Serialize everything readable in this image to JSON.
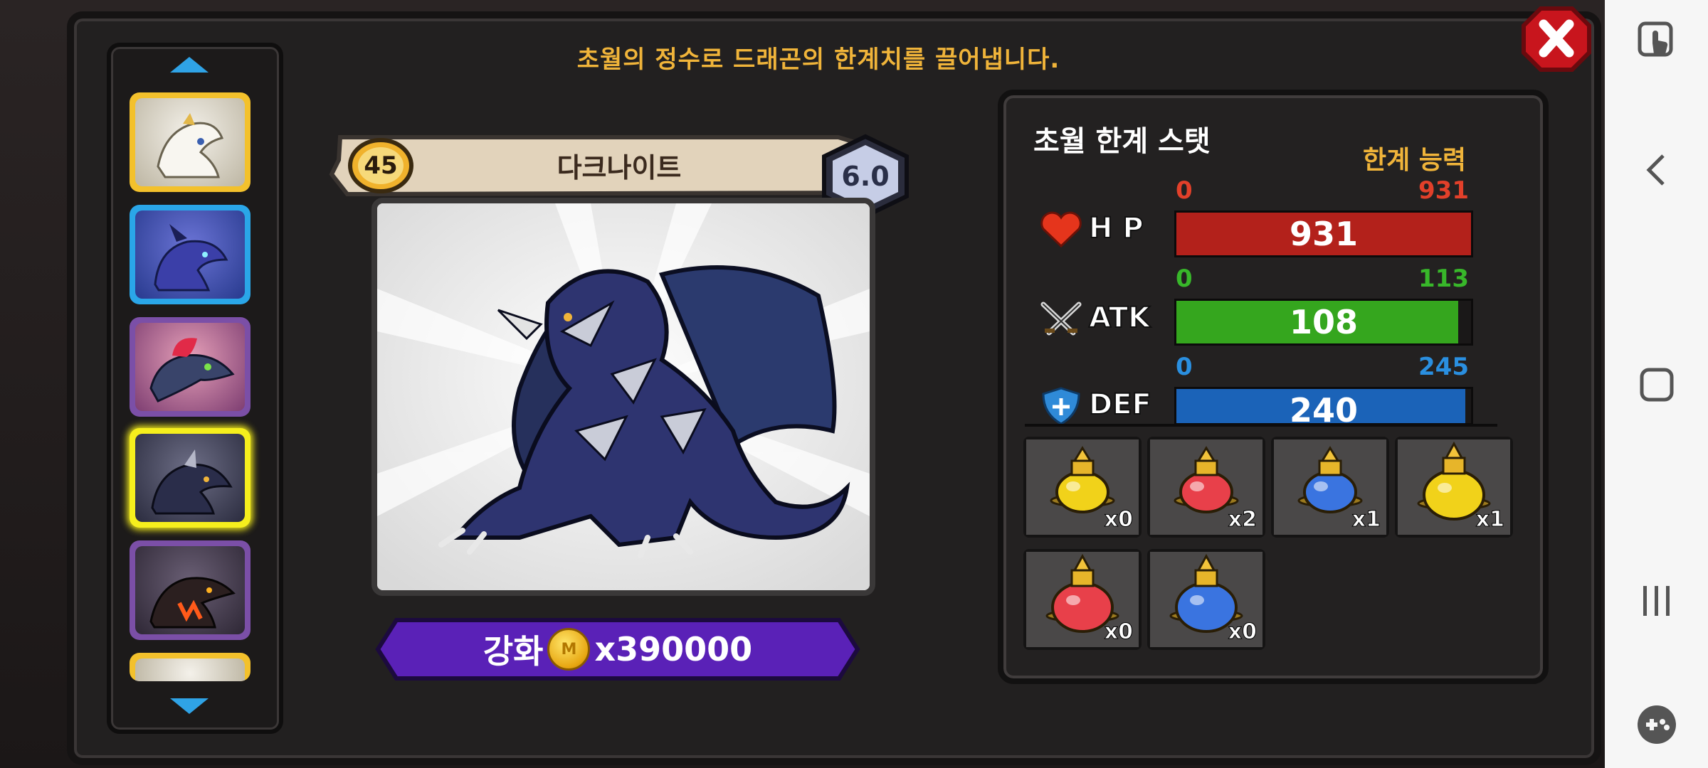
{
  "header": {
    "message": "초월의 정수로 드래곤의 한계치를 끌어냅니다."
  },
  "dragon_list": {
    "slots": [
      {
        "name": "white-dragon",
        "frame_color": "#f3c12c"
      },
      {
        "name": "blue-dragon",
        "frame_color": "#2aa6e8"
      },
      {
        "name": "pink-dragon",
        "frame_color": "#7b4fa7"
      },
      {
        "name": "dark-knight-dragon",
        "frame_color": "#f6ef1d",
        "selected": true
      },
      {
        "name": "fire-dragon",
        "frame_color": "#7b4fa7"
      },
      {
        "name": "white-dragon-partial",
        "frame_color": "#f3c12c"
      }
    ]
  },
  "dragon": {
    "level": "45",
    "name": "다크나이트",
    "grade": "6.0"
  },
  "upgrade": {
    "label": "강화",
    "coin_letter": "M",
    "cost": "x390000"
  },
  "stats_panel": {
    "title": "초월 한계 스탯",
    "limit_label": "한계 능력",
    "stats": [
      {
        "key": "hp",
        "label": "H P",
        "min": "0",
        "max": "931",
        "value": "931",
        "fill": 1.0,
        "color": "#b3211b",
        "label_color": "#e2402a"
      },
      {
        "key": "atk",
        "label": "ATK",
        "min": "0",
        "max": "113",
        "value": "108",
        "fill": 0.956,
        "color": "#35a61e",
        "label_color": "#38b72a"
      },
      {
        "key": "def",
        "label": "DEF",
        "min": "0",
        "max": "245",
        "value": "240",
        "fill": 0.98,
        "color": "#1b63b8",
        "label_color": "#2a8fe0"
      }
    ]
  },
  "potions": [
    {
      "name": "yellow-potion",
      "count": "x0",
      "color": "#f1d21a"
    },
    {
      "name": "red-potion",
      "count": "x2",
      "color": "#e8404a"
    },
    {
      "name": "blue-potion",
      "count": "x1",
      "color": "#3a74e0"
    },
    {
      "name": "large-yellow-potion",
      "count": "x1",
      "color": "#f1d21a"
    },
    {
      "name": "large-red-potion",
      "count": "x0",
      "color": "#e8404a"
    },
    {
      "name": "large-blue-potion",
      "count": "x0",
      "color": "#3a74e0"
    }
  ]
}
